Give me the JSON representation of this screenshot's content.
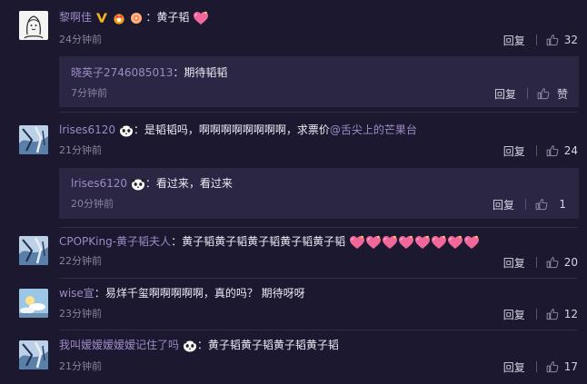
{
  "comments": [
    {
      "username": "黎啊佳",
      "sep": "：",
      "text": "黄子韬",
      "time": "24分钟前",
      "reply_label": "回复",
      "like_count": "32",
      "subreply": {
        "username": "晓英子2746085013",
        "sep": "：",
        "text": "期待韬韬",
        "time": "7分钟前",
        "reply_label": "回复",
        "like_label": "赞"
      }
    },
    {
      "username": "lrises6120",
      "sep": "：",
      "text": "是韬韬吗，啊啊啊啊啊啊啊啊，求票价",
      "mention": "@舌尖上的芒果台",
      "time": "21分钟前",
      "reply_label": "回复",
      "like_count": "24",
      "subreply": {
        "username": "lrises6120",
        "sep": "：",
        "text": "看过来，看过来",
        "time": "20分钟前",
        "reply_label": "回复",
        "like_count": "1"
      }
    },
    {
      "username": "CPOPKing-黄子韬夫人",
      "sep": "：",
      "text": "黄子韬黄子韬黄子韬黄子韬黄子韬",
      "time": "22分钟前",
      "reply_label": "回复",
      "like_count": "20"
    },
    {
      "username": "wise宣",
      "sep": "：",
      "text": "易烊千玺啊啊啊啊啊，真的吗？ 期待呀呀",
      "time": "23分钟前",
      "reply_label": "回复",
      "like_count": "12"
    },
    {
      "username": "我叫嫒嫒嫒嫒嫒记住了吗",
      "sep": "：",
      "text": "黄子韬黄子韬黄子韬黄子韬",
      "time": "21分钟前",
      "reply_label": "回复",
      "like_count": "17"
    }
  ],
  "icons": {
    "like": "thumbs-up-icon",
    "heart": "heart-emoji-icon",
    "panda": "panda-emoji-icon"
  },
  "colors": {
    "background": "#1c1830",
    "subreply_bg": "#2b2644",
    "username": "#9c8cc4",
    "time": "#8a839b",
    "heart": "#f2679a"
  }
}
